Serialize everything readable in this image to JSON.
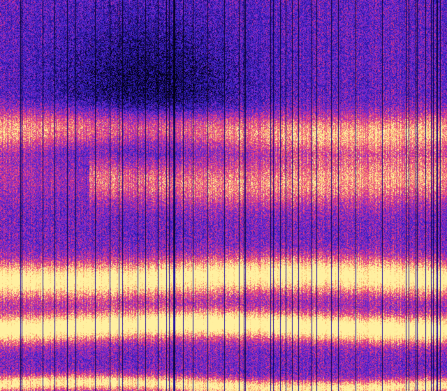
{
  "image": {
    "kind": "spectrogram",
    "colormap": [
      "#000008",
      "#1a0a7a",
      "#3020c0",
      "#5a28d0",
      "#9a2cc8",
      "#d8307a",
      "#f0508a",
      "#f8a060",
      "#fff0a0"
    ],
    "bands": [
      {
        "name": "band-1",
        "level": 0.55,
        "center_fraction": 0.335,
        "width_fraction": 0.05
      },
      {
        "name": "band-2",
        "level": 0.8,
        "center_fraction": 0.71,
        "width_fraction": 0.045
      },
      {
        "name": "band-3",
        "level": 0.88,
        "center_fraction": 0.835,
        "width_fraction": 0.035
      },
      {
        "name": "band-4",
        "level": 0.7,
        "center_fraction": 0.985,
        "width_fraction": 0.02
      },
      {
        "name": "band-5",
        "level": 0.45,
        "center_fraction": 0.46,
        "width_fraction": 0.06
      }
    ],
    "dark_region": {
      "level": 0.15
    },
    "background_level": 0.38
  }
}
